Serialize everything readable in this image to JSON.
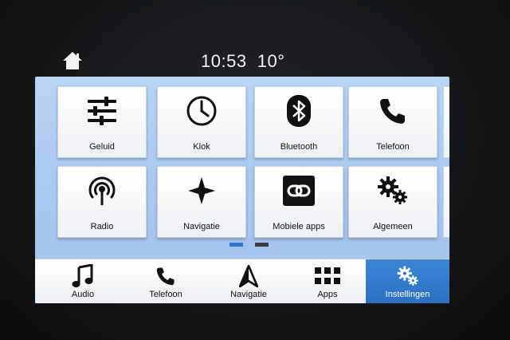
{
  "status_bar": {
    "time": "10:53",
    "temperature": "10°",
    "home_icon": "home-icon"
  },
  "tiles": [
    {
      "label": "Geluid",
      "icon": "equalizer-icon"
    },
    {
      "label": "Klok",
      "icon": "clock-icon"
    },
    {
      "label": "Bluetooth",
      "icon": "bluetooth-icon"
    },
    {
      "label": "Telefoon",
      "icon": "phone-icon"
    },
    {
      "label": "Radio",
      "icon": "radio-antenna-icon"
    },
    {
      "label": "Navigatie",
      "icon": "compass-star-icon"
    },
    {
      "label": "Mobiele apps",
      "icon": "link-icon"
    },
    {
      "label": "Algemeen",
      "icon": "gears-icon"
    }
  ],
  "pagination": {
    "pages": 2,
    "current": 1
  },
  "nav_bar": [
    {
      "label": "Audio",
      "icon": "music-note-icon",
      "active": false
    },
    {
      "label": "Telefoon",
      "icon": "phone-icon",
      "active": false
    },
    {
      "label": "Navigatie",
      "icon": "navigation-arrow-icon",
      "active": false
    },
    {
      "label": "Apps",
      "icon": "grid-icon",
      "active": false
    },
    {
      "label": "Instellingen",
      "icon": "gears-icon",
      "active": true
    }
  ],
  "colors": {
    "screen_background": "#b0cdf1",
    "active_nav": "#2f78cc",
    "page_dot_active": "#2f78cc",
    "page_dot_inactive": "#3a3f47"
  }
}
